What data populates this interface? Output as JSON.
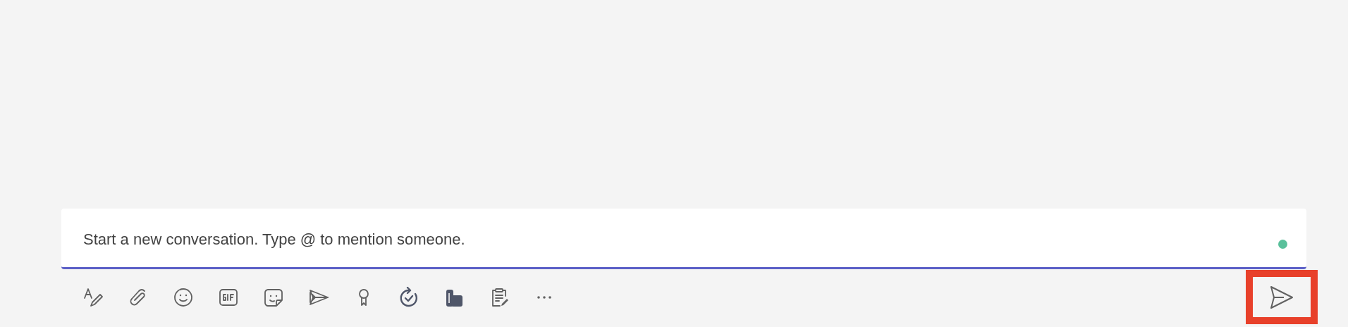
{
  "compose_box": {
    "placeholder": "Start a new conversation. Type @ to mention someone."
  }
}
